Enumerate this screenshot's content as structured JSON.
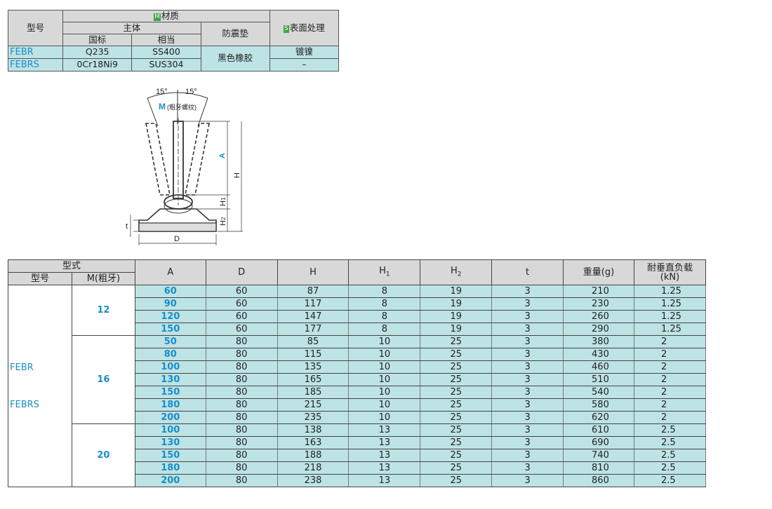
{
  "material_table": {
    "header_model": "型号",
    "header_material": "材质",
    "material_badge": "M",
    "header_body": "主体",
    "header_national": "国标",
    "header_equivalent": "相当",
    "header_pad": "防震垫",
    "header_surface": "表面处理",
    "surface_badge": "S",
    "rows": [
      {
        "model": "FEBR",
        "national": "Q235",
        "equivalent": "SS400",
        "surface": "镀镍"
      },
      {
        "model": "FEBRS",
        "national": "0Cr18Ni9",
        "equivalent": "SUS304",
        "surface": "–"
      }
    ],
    "pad_value": "黑色橡胶"
  },
  "drawing": {
    "angle_left": "15°",
    "angle_right": "15°",
    "thread_label": "M",
    "thread_note": "(粗牙螺纹)",
    "dim_A": "A",
    "dim_H": "H",
    "dim_H1": "H",
    "dim_H1_sub": "1",
    "dim_H2": "H",
    "dim_H2_sub": "2",
    "dim_t": "t",
    "dim_D": "D"
  },
  "spec_table": {
    "header_type": "型式",
    "header_model": "型号",
    "header_m": "M(粗牙)",
    "header_A": "A",
    "header_D": "D",
    "header_H": "H",
    "header_H1": "H",
    "header_H1_sub": "1",
    "header_H2": "H",
    "header_H2_sub": "2",
    "header_t": "t",
    "header_weight": "重量(g)",
    "header_load": "耐垂直负载",
    "header_load_unit": "(kN)",
    "model_1": "FEBR",
    "model_2": "FEBRS",
    "groups": [
      {
        "m": "12",
        "rows": [
          {
            "A": "60",
            "D": "60",
            "H": "87",
            "H1": "8",
            "H2": "19",
            "t": "3",
            "weight": "210",
            "load": "1.25"
          },
          {
            "A": "90",
            "D": "60",
            "H": "117",
            "H1": "8",
            "H2": "19",
            "t": "3",
            "weight": "230",
            "load": "1.25"
          },
          {
            "A": "120",
            "D": "60",
            "H": "147",
            "H1": "8",
            "H2": "19",
            "t": "3",
            "weight": "260",
            "load": "1.25"
          },
          {
            "A": "150",
            "D": "60",
            "H": "177",
            "H1": "8",
            "H2": "19",
            "t": "3",
            "weight": "290",
            "load": "1.25"
          }
        ]
      },
      {
        "m": "16",
        "rows": [
          {
            "A": "50",
            "D": "80",
            "H": "85",
            "H1": "10",
            "H2": "25",
            "t": "3",
            "weight": "380",
            "load": "2"
          },
          {
            "A": "80",
            "D": "80",
            "H": "115",
            "H1": "10",
            "H2": "25",
            "t": "3",
            "weight": "430",
            "load": "2"
          },
          {
            "A": "100",
            "D": "80",
            "H": "135",
            "H1": "10",
            "H2": "25",
            "t": "3",
            "weight": "460",
            "load": "2"
          },
          {
            "A": "130",
            "D": "80",
            "H": "165",
            "H1": "10",
            "H2": "25",
            "t": "3",
            "weight": "510",
            "load": "2"
          },
          {
            "A": "150",
            "D": "80",
            "H": "185",
            "H1": "10",
            "H2": "25",
            "t": "3",
            "weight": "540",
            "load": "2"
          },
          {
            "A": "180",
            "D": "80",
            "H": "215",
            "H1": "10",
            "H2": "25",
            "t": "3",
            "weight": "580",
            "load": "2"
          },
          {
            "A": "200",
            "D": "80",
            "H": "235",
            "H1": "10",
            "H2": "25",
            "t": "3",
            "weight": "620",
            "load": "2"
          }
        ]
      },
      {
        "m": "20",
        "rows": [
          {
            "A": "100",
            "D": "80",
            "H": "138",
            "H1": "13",
            "H2": "25",
            "t": "3",
            "weight": "610",
            "load": "2.5"
          },
          {
            "A": "130",
            "D": "80",
            "H": "163",
            "H1": "13",
            "H2": "25",
            "t": "3",
            "weight": "690",
            "load": "2.5"
          },
          {
            "A": "150",
            "D": "80",
            "H": "188",
            "H1": "13",
            "H2": "25",
            "t": "3",
            "weight": "740",
            "load": "2.5"
          },
          {
            "A": "180",
            "D": "80",
            "H": "218",
            "H1": "13",
            "H2": "25",
            "t": "3",
            "weight": "810",
            "load": "2.5"
          },
          {
            "A": "200",
            "D": "80",
            "H": "238",
            "H1": "13",
            "H2": "25",
            "t": "3",
            "weight": "860",
            "load": "2.5"
          }
        ]
      }
    ]
  }
}
